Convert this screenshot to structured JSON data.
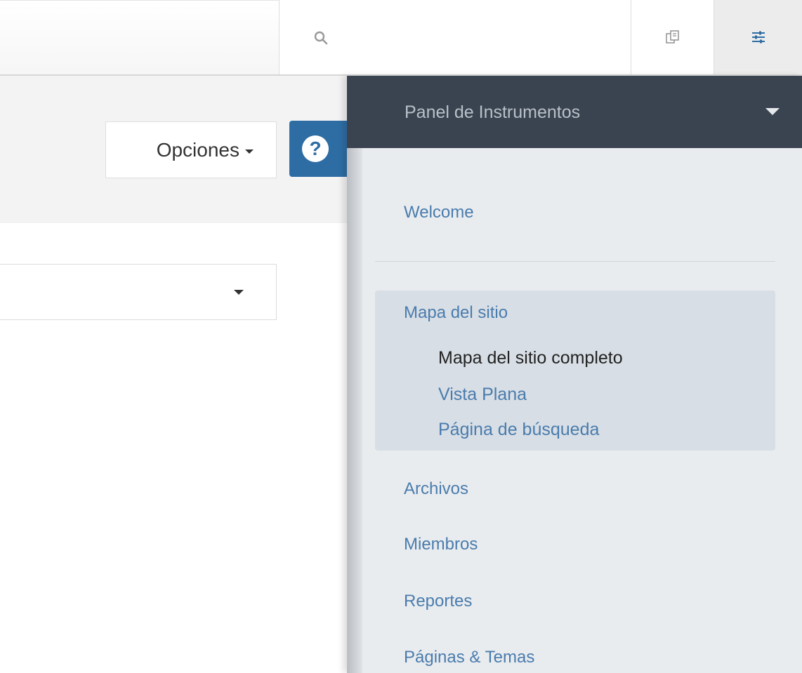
{
  "toolbar": {
    "search_icon": "search-icon",
    "copy_icon": "copy-icon",
    "settings_icon": "sliders-icon"
  },
  "header": {
    "options_label": "Opciones",
    "help_label": "?"
  },
  "panel": {
    "title": "Panel de Instrumentos",
    "items": [
      {
        "label": "Welcome"
      },
      {
        "label": "Mapa del sitio"
      },
      {
        "label": "Archivos"
      },
      {
        "label": "Miembros"
      },
      {
        "label": "Reportes"
      },
      {
        "label": "Páginas & Temas"
      }
    ],
    "sitemap_children": [
      {
        "label": "Mapa del sitio completo",
        "active": true
      },
      {
        "label": "Vista Plana"
      },
      {
        "label": "Página de búsqueda"
      }
    ]
  },
  "colors": {
    "panel_header": "#3a4450",
    "link": "#4a7cad",
    "help_button": "#2e6da4"
  }
}
